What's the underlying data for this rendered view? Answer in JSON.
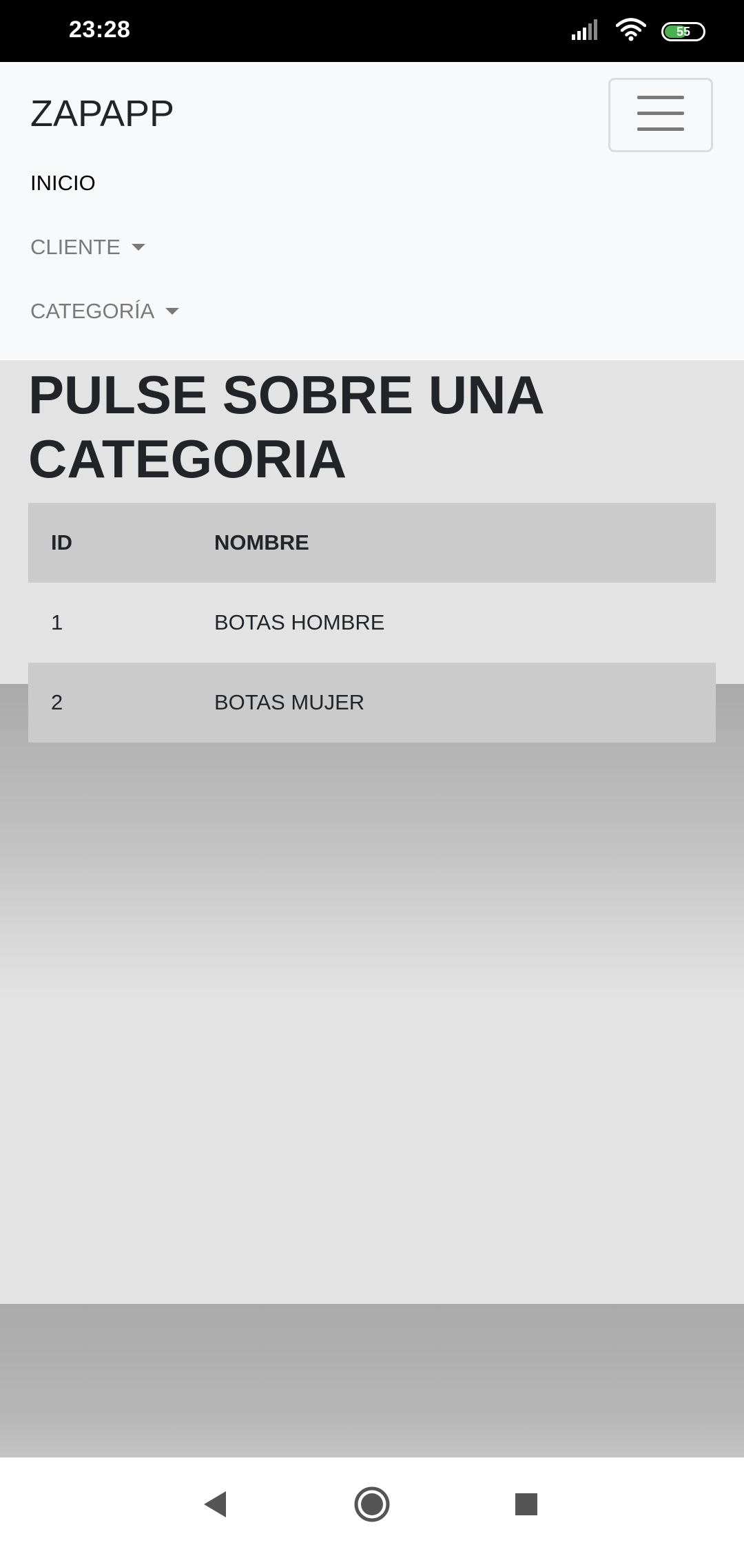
{
  "status_bar": {
    "time": "23:28",
    "battery_level": "55",
    "icons": [
      "signal-icon",
      "wifi-icon",
      "battery-icon"
    ]
  },
  "navbar": {
    "brand": "ZAPAPP",
    "toggler_icon": "hamburger-menu-icon",
    "links": [
      {
        "label": "INICIO"
      },
      {
        "label": "CLIENTE"
      },
      {
        "label": "CATEGORÍA"
      }
    ]
  },
  "main": {
    "title": "PULSE SOBRE UNA CATEGORIA",
    "table": {
      "headers": [
        "ID",
        "NOMBRE"
      ],
      "rows": [
        [
          "1",
          "BOTAS HOMBRE"
        ],
        [
          "2",
          "BOTAS MUJER"
        ]
      ]
    }
  },
  "system_nav": {
    "buttons": [
      "back-icon",
      "home-icon",
      "recents-icon"
    ]
  },
  "colors": {
    "navbar_bg": "#f8f9fa",
    "text": "#212529",
    "muted_text": "#7a7a7a",
    "striped_row": "#cbcbcb",
    "battery_green": "#4caf50"
  }
}
